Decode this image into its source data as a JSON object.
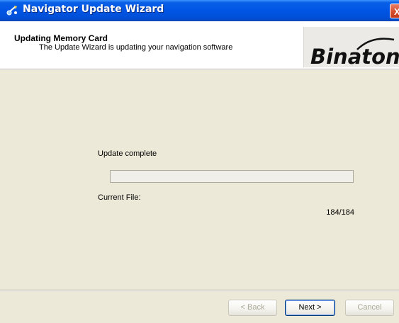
{
  "window": {
    "title": "Navigator Update Wizard",
    "close_label": "X"
  },
  "header": {
    "title": "Updating Memory Card",
    "subtitle": "The Update Wizard is updating your navigation software",
    "logo_text": "Binatone"
  },
  "body": {
    "status": "Update complete",
    "progress_percent": 0,
    "current_file_label": "Current File:",
    "file_count": "184/184"
  },
  "buttons": {
    "back": "< Back",
    "next": "Next >",
    "cancel": "Cancel"
  },
  "colors": {
    "titlebar": "#0055e5",
    "dialog_bg": "#ece9d8",
    "close_button": "#d8512f"
  },
  "icons": {
    "title": "navigator-app-icon",
    "close": "close-icon"
  }
}
